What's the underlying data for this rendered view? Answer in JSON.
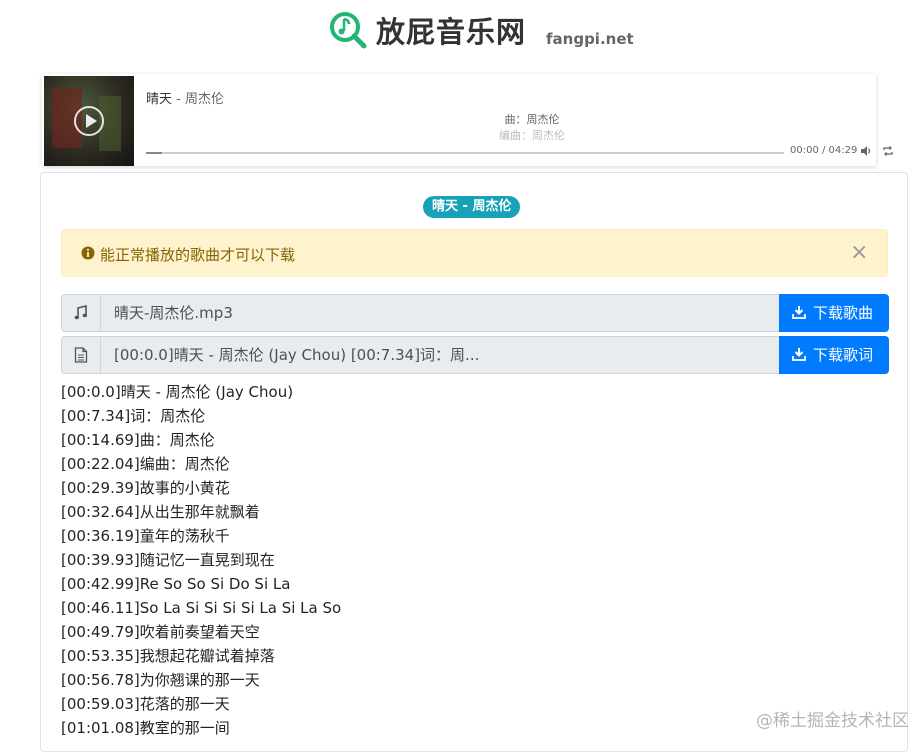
{
  "header": {
    "logo_icon": "music-search-icon",
    "site_name": "放屁音乐网",
    "site_domain": "fangpi.net",
    "brand_color": "#22b573"
  },
  "player": {
    "cover_icon": "play-icon",
    "track_title": "晴天",
    "separator": " - ",
    "artist": "周杰伦",
    "current_lyric": "曲：周杰伦",
    "next_lyric": "编曲：周杰伦",
    "progress": 0.025,
    "time": "00:00 / 04:29",
    "volume_icon": "volume-icon",
    "loop_icon": "loop-icon"
  },
  "card": {
    "badge": "晴天 - 周杰伦",
    "badge_color": "#17a2b8",
    "alert": {
      "icon": "info-circle-icon",
      "text": "能正常播放的歌曲才可以下载",
      "close": "×"
    },
    "song_file": {
      "icon": "music-note-icon",
      "value": "晴天-周杰伦.mp3",
      "button": "下载歌曲"
    },
    "lyric_file": {
      "icon": "document-icon",
      "value": "[00:0.0]晴天 - 周杰伦 (Jay Chou) [00:7.34]词：周...",
      "button": "下载歌词"
    },
    "button_color": "#007bff",
    "lyrics": [
      "[00:0.0]晴天 - 周杰伦 (Jay Chou)",
      "[00:7.34]词：周杰伦",
      "[00:14.69]曲：周杰伦",
      "[00:22.04]编曲：周杰伦",
      "[00:29.39]故事的小黄花",
      "[00:32.64]从出生那年就飘着",
      "[00:36.19]童年的荡秋千",
      "[00:39.93]随记忆一直晃到现在",
      "[00:42.99]Re So So Si Do Si La",
      "[00:46.11]So La Si Si Si Si La Si La So",
      "[00:49.79]吹着前奏望着天空",
      "[00:53.35]我想起花瓣试着掉落",
      "[00:56.78]为你翘课的那一天",
      "[00:59.03]花落的那一天",
      "[01:01.08]教室的那一间"
    ]
  },
  "watermark": "@稀土掘金技术社区"
}
